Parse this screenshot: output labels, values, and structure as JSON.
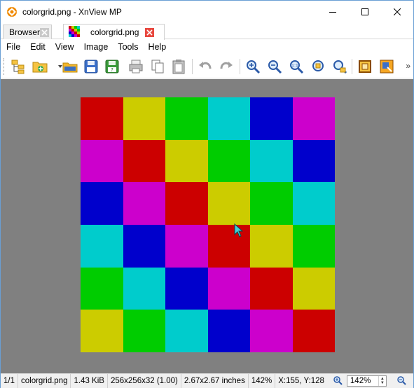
{
  "window": {
    "title": "colorgrid.png - XnView MP",
    "controls": [
      "minimize",
      "maximize",
      "close"
    ]
  },
  "tabs": [
    {
      "label": "Browser",
      "active": false
    },
    {
      "label": "colorgrid.png",
      "active": true
    }
  ],
  "menu": [
    "File",
    "Edit",
    "View",
    "Image",
    "Tools",
    "Help"
  ],
  "toolbar": {
    "buttons": [
      "tree-view-icon",
      "open-folder-icon",
      "folder-icon",
      "save-icon",
      "save-as-icon",
      "print-icon",
      "copy-icon",
      "paste-icon",
      "undo-icon",
      "redo-icon",
      "zoom-in-icon",
      "zoom-out-icon",
      "zoom-1to1-icon",
      "zoom-fit-icon",
      "zoom-lock-icon",
      "crop-icon",
      "resize-icon"
    ],
    "more_label": "»"
  },
  "image_grid": {
    "colors": {
      "R": "#cc0000",
      "Y": "#cccc00",
      "G": "#00cc00",
      "C": "#00cccc",
      "B": "#0000cc",
      "M": "#cc00cc"
    },
    "rows": [
      [
        "R",
        "Y",
        "G",
        "C",
        "B",
        "M"
      ],
      [
        "M",
        "R",
        "Y",
        "G",
        "C",
        "B"
      ],
      [
        "B",
        "M",
        "R",
        "Y",
        "G",
        "C"
      ],
      [
        "C",
        "B",
        "M",
        "R",
        "Y",
        "G"
      ],
      [
        "G",
        "C",
        "B",
        "M",
        "R",
        "Y"
      ],
      [
        "Y",
        "G",
        "C",
        "B",
        "M",
        "R"
      ]
    ]
  },
  "status": {
    "index": "1/1",
    "filename": "colorgrid.png",
    "filesize": "1.43 KiB",
    "dimensions": "256x256x32 (1.00)",
    "print_size": "2.67x2.67 inches",
    "zoom_percent": "142%",
    "coords": "X:155, Y:128",
    "zoom_value": "142%"
  },
  "theme": {
    "canvas_bg": "#808080",
    "accent": "#e8483f"
  }
}
